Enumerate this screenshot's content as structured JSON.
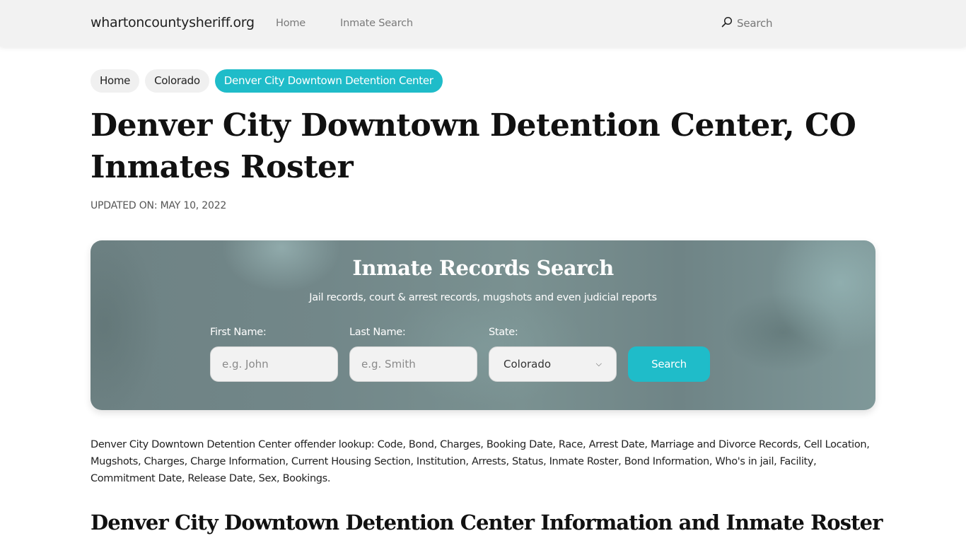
{
  "navbar": {
    "brand": "whartoncountysheriff.org",
    "links": [
      {
        "label": "Home"
      },
      {
        "label": "Inmate Search"
      }
    ],
    "search_label": "Search",
    "search_icon": "search-icon"
  },
  "breadcrumb": [
    {
      "label": "Home"
    },
    {
      "label": "Colorado"
    },
    {
      "label": "Denver City Downtown Detention Center",
      "active": true
    }
  ],
  "page": {
    "title": "Denver City Downtown Detention Center, CO Inmates Roster",
    "updated": "UPDATED ON: MAY 10, 2022"
  },
  "search_hero": {
    "title": "Inmate Records Search",
    "subtitle": "Jail records, court & arrest records, mugshots and even judicial reports",
    "first_name": {
      "label": "First Name:",
      "placeholder": "e.g. John",
      "value": ""
    },
    "last_name": {
      "label": "Last Name:",
      "placeholder": "e.g. Smith",
      "value": ""
    },
    "state": {
      "label": "State:",
      "selected": "Colorado"
    },
    "button_label": "Search",
    "accent_color": "#1fbcc9"
  },
  "description": "Denver City Downtown Detention Center offender lookup: Code, Bond, Charges, Booking Date, Race, Arrest Date, Marriage and Divorce Records, Cell Location, Mugshots, Charges, Charge Information, Current Housing Section, Institution, Arrests, Status, Inmate Roster, Bond Information, Who's in jail, Facility, Commitment Date, Release Date, Sex, Bookings.",
  "section_heading": "Denver City Downtown Detention Center Information and Inmate Roster"
}
